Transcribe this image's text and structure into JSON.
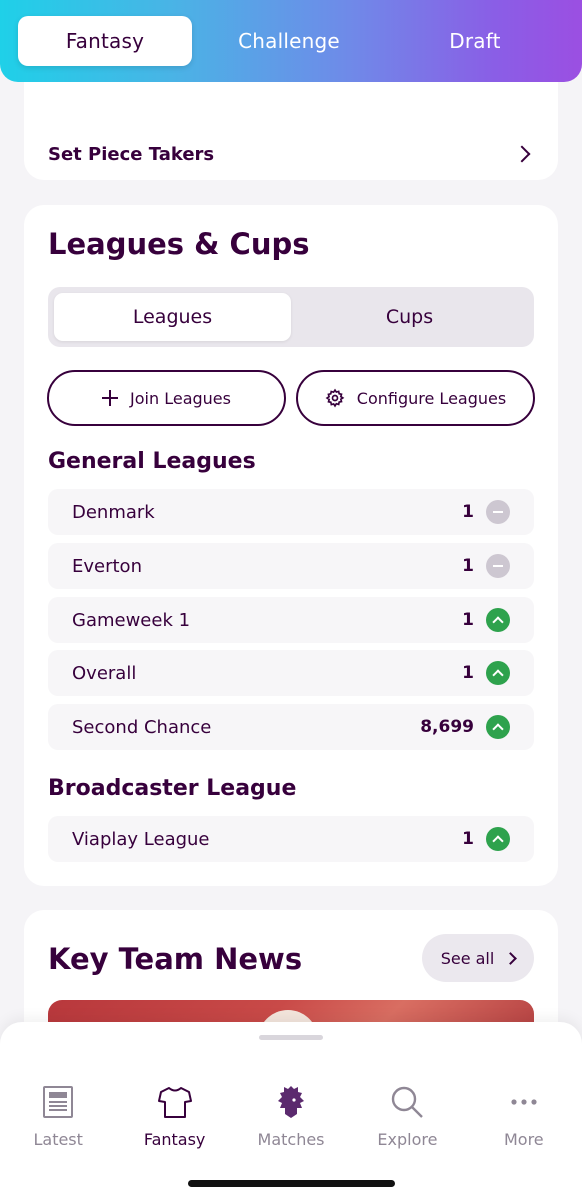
{
  "top_nav": {
    "tabs": [
      {
        "label": "Fantasy",
        "active": true
      },
      {
        "label": "Challenge",
        "active": false
      },
      {
        "label": "Draft",
        "active": false
      }
    ]
  },
  "set_piece": {
    "label": "Set Piece Takers"
  },
  "leagues_card": {
    "title": "Leagues & Cups",
    "segments": [
      {
        "label": "Leagues",
        "active": true
      },
      {
        "label": "Cups",
        "active": false
      }
    ],
    "join_label": "Join Leagues",
    "configure_label": "Configure Leagues",
    "general_title": "General Leagues",
    "general": [
      {
        "name": "Denmark",
        "rank": "1",
        "movement": "same"
      },
      {
        "name": "Everton",
        "rank": "1",
        "movement": "same"
      },
      {
        "name": "Gameweek 1",
        "rank": "1",
        "movement": "up"
      },
      {
        "name": "Overall",
        "rank": "1",
        "movement": "up"
      },
      {
        "name": "Second Chance",
        "rank": "8,699",
        "movement": "up"
      }
    ],
    "broadcaster_title": "Broadcaster League",
    "broadcaster": [
      {
        "name": "Viaplay League",
        "rank": "1",
        "movement": "up"
      }
    ]
  },
  "news": {
    "title": "Key Team News",
    "see_all": "See all"
  },
  "bottom_tabs": [
    {
      "label": "Latest",
      "icon": "latest-icon",
      "active": false
    },
    {
      "label": "Fantasy",
      "icon": "shirt-icon",
      "active": true
    },
    {
      "label": "Matches",
      "icon": "lion-icon",
      "active": false
    },
    {
      "label": "Explore",
      "icon": "search-icon",
      "active": false
    },
    {
      "label": "More",
      "icon": "more-icon",
      "active": false
    }
  ],
  "colors": {
    "brand": "#37003c",
    "up": "#2ea24d",
    "same": "#cdc7d1"
  }
}
